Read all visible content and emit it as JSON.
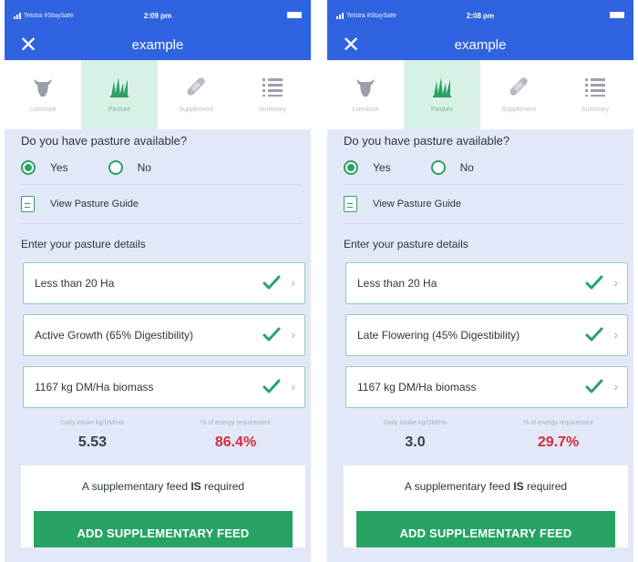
{
  "screens": [
    {
      "status": {
        "carrier": "Telstra #StaySafe",
        "time": "2:09 pm"
      },
      "appbar": {
        "close_icon": "close-icon",
        "title": "example"
      },
      "tabs": [
        {
          "label": "Livestock",
          "icon": "cow-icon"
        },
        {
          "label": "Pasture",
          "icon": "grass-icon",
          "active": true
        },
        {
          "label": "Supplement",
          "icon": "bandage-icon"
        },
        {
          "label": "Summary",
          "icon": "list-icon"
        }
      ],
      "question": "Do you have pasture available?",
      "options": {
        "yes": "Yes",
        "no": "No",
        "selected": "Yes"
      },
      "guide_label": "View Pasture Guide",
      "section_title": "Enter your pasture details",
      "fields": [
        {
          "value": "Less than 20 Ha"
        },
        {
          "value": "Active Growth (65% Digestibility)"
        },
        {
          "value": "1167 kg DM/Ha biomass"
        }
      ],
      "stats": {
        "intake_label": "Daily intake kg/DM/Ha",
        "intake_value": "5.53",
        "energy_label": "% of energy requirement",
        "energy_value": "86.4%"
      },
      "notice": {
        "before": "A supplementary feed ",
        "emphasis": "IS",
        "after": " required"
      },
      "button_label": "ADD SUPPLEMENTARY FEED"
    },
    {
      "status": {
        "carrier": "Telstra #StaySafe",
        "time": "2:08 pm"
      },
      "appbar": {
        "close_icon": "close-icon",
        "title": "example"
      },
      "tabs": [
        {
          "label": "Livestock",
          "icon": "cow-icon"
        },
        {
          "label": "Pasture",
          "icon": "grass-icon",
          "active": true
        },
        {
          "label": "Supplement",
          "icon": "bandage-icon"
        },
        {
          "label": "Summary",
          "icon": "list-icon"
        }
      ],
      "question": "Do you have pasture available?",
      "options": {
        "yes": "Yes",
        "no": "No",
        "selected": "Yes"
      },
      "guide_label": "View Pasture Guide",
      "section_title": "Enter your pasture details",
      "fields": [
        {
          "value": "Less than 20 Ha"
        },
        {
          "value": "Late Flowering (45% Digestibility)"
        },
        {
          "value": "1167 kg DM/Ha biomass"
        }
      ],
      "stats": {
        "intake_label": "Daily intake kg/DM/Ha",
        "intake_value": "3.0",
        "energy_label": "% of energy requirement",
        "energy_value": "29.7%"
      },
      "notice": {
        "before": "A supplementary feed ",
        "emphasis": "IS",
        "after": " required"
      },
      "button_label": "ADD SUPPLEMENTARY FEED"
    }
  ],
  "colors": {
    "brand_blue": "#2f63df",
    "accent_green": "#27a464",
    "alert_red": "#d22d3c",
    "active_tab_bg": "#d8f1e5"
  }
}
